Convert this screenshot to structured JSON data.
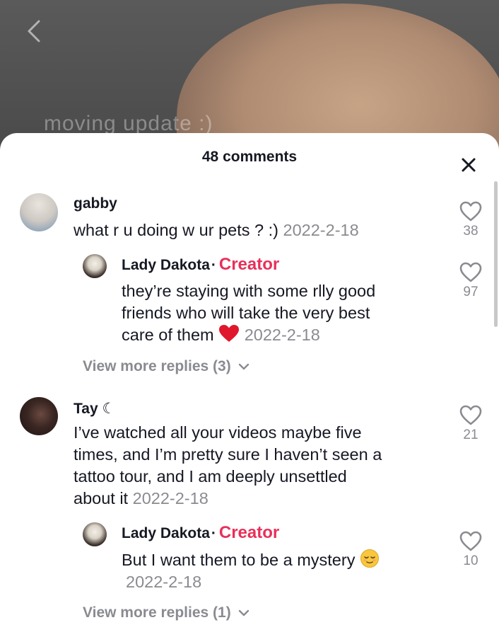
{
  "video": {
    "caption": "moving update :)"
  },
  "sheet": {
    "title": "48 comments"
  },
  "comments": [
    {
      "username": "gabby",
      "text": "what r u doing w ur pets ? :)",
      "date": "2022-2-18",
      "likes": "38",
      "reply": {
        "username": "Lady Dakota",
        "badge": "Creator",
        "text_line1": "they’re staying with some rlly good",
        "text_line2": "friends who will take the very best",
        "text_line3": "care of them",
        "date": "2022-2-18",
        "likes": "97"
      },
      "view_more": "View more replies (3)"
    },
    {
      "username": "Tay ☾",
      "text_line1": "I’ve watched all your videos maybe five",
      "text_line2": "times, and I’m pretty sure I haven’t seen a",
      "text_line3": "tattoo tour, and I am deeply unsettled",
      "text_line4": "about it",
      "date": "2022-2-18",
      "likes": "21",
      "reply": {
        "username": "Lady Dakota",
        "badge": "Creator",
        "text": "But I want them to be a mystery",
        "date": "2022-2-18",
        "likes": "10"
      },
      "view_more": "View more replies (1)"
    }
  ],
  "colors": {
    "creator": "#e8305a",
    "muted": "#8a8b91",
    "text": "#161823"
  },
  "icons": [
    "back-icon",
    "close-icon",
    "heart-outline-icon",
    "red-heart-emoji-icon",
    "relieved-face-emoji-icon",
    "chevron-down-icon"
  ]
}
